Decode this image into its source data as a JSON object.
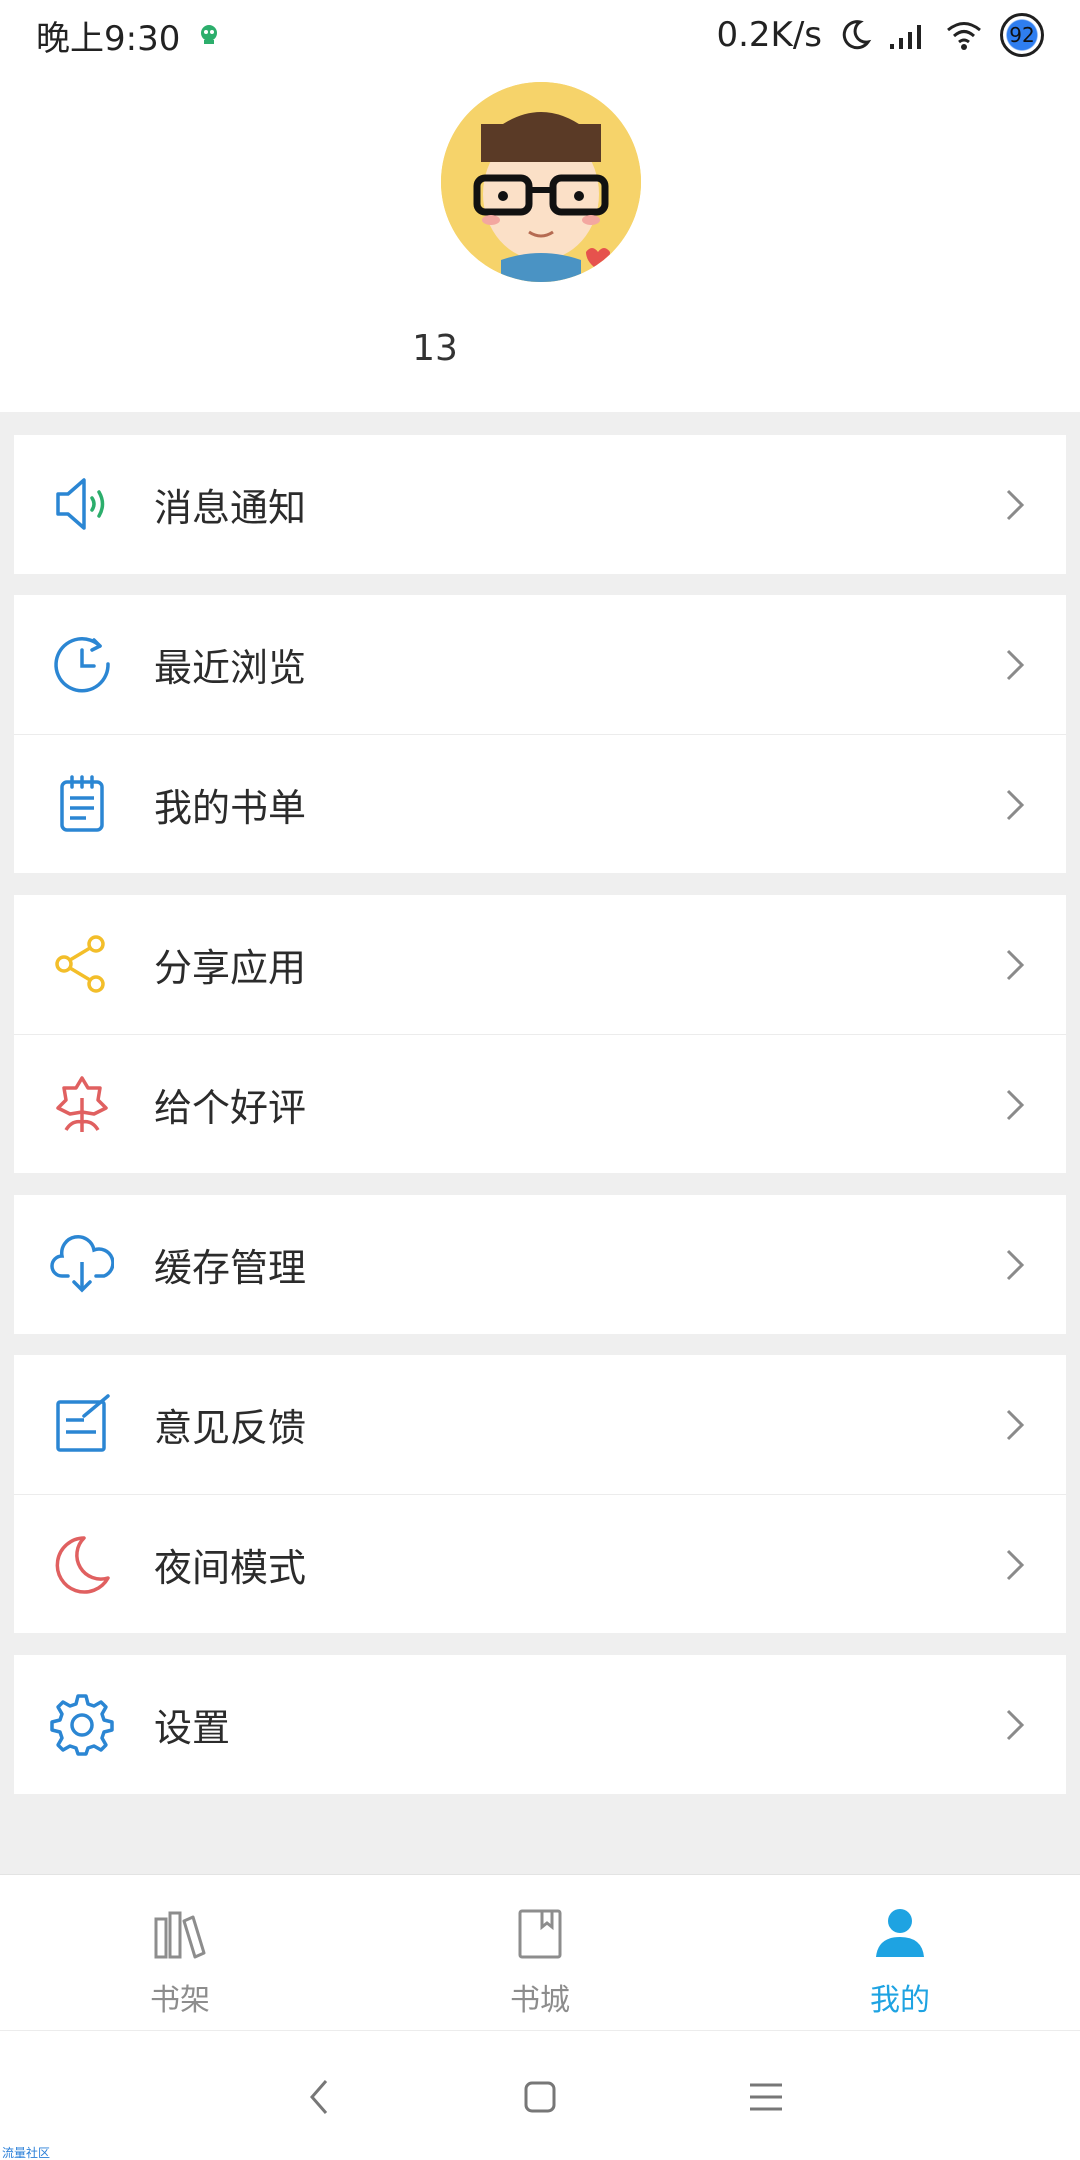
{
  "status_bar": {
    "time": "晚上9:30",
    "net_speed": "0.2K/s",
    "battery": "92"
  },
  "profile": {
    "phone": "13"
  },
  "menu": {
    "notifications": "消息通知",
    "recent": "最近浏览",
    "booklist": "我的书单",
    "share": "分享应用",
    "rate": "给个好评",
    "cache": "缓存管理",
    "feedback": "意见反馈",
    "night": "夜间模式",
    "settings": "设置"
  },
  "tabs": {
    "bookshelf": "书架",
    "bookstore": "书城",
    "mine": "我的"
  },
  "watermark": "流量社区",
  "colors": {
    "accent": "#1ea3e2",
    "icon_blue": "#2b86d3",
    "icon_yellow": "#f3be2a",
    "icon_red": "#e06060",
    "icon_green": "#2cae6c",
    "background": "#efefef"
  }
}
